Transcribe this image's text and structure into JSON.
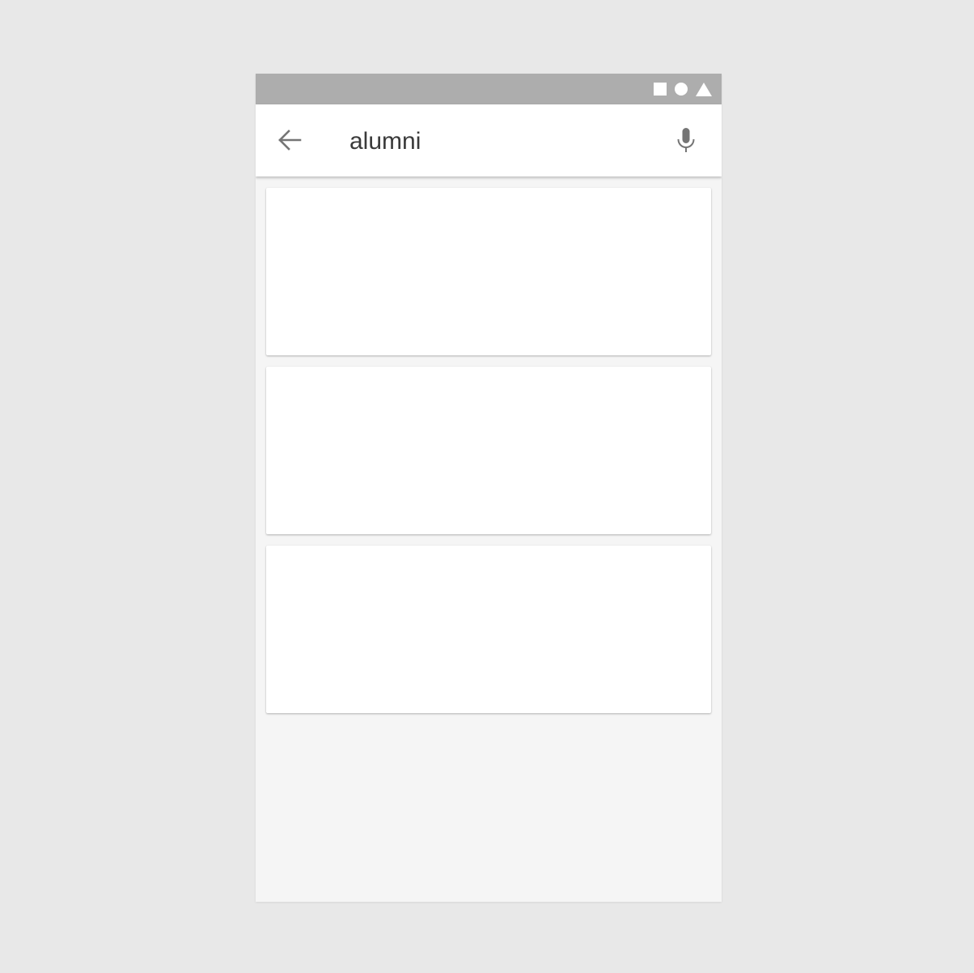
{
  "status_bar": {
    "icons": [
      "square-icon",
      "circle-icon",
      "triangle-icon"
    ],
    "background_color": "#adadad"
  },
  "search_bar": {
    "back_icon": "arrow-left-icon",
    "query": "alumni",
    "mic_icon": "microphone-icon"
  },
  "results": {
    "cards": [
      {
        "index": 1
      },
      {
        "index": 2
      },
      {
        "index": 3
      }
    ]
  }
}
